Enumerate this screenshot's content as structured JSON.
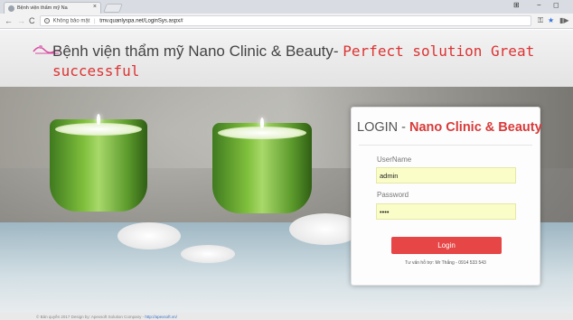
{
  "browser": {
    "tab_title": "Bệnh viện thẩm mỹ Na",
    "tab_close": "×",
    "window_controls": [
      "─",
      "−",
      "◻"
    ],
    "security_label": "Không bảo mật",
    "url": "tmv.quanlyspa.net/LoginSys.aspx#",
    "icons": [
      "key-icon",
      "star-icon",
      "extension-icon"
    ]
  },
  "header": {
    "title_main": "Bệnh viện thẩm mỹ Nano Clinic & Beauty-",
    "title_accent": "Perfect solution Great successful"
  },
  "login": {
    "title_prefix": "LOGIN - ",
    "title_brand": "Nano Clinic & Beauty",
    "username_label": "UserName",
    "username_value": "admin",
    "password_label": "Password",
    "password_value": "••••",
    "button_label": "Login",
    "support_text": "Tư vấn hỗ trợ: Mr Thắng - 0914 533 543"
  },
  "footer": {
    "left_text": "© Bản quyền 2017   Design by: Apexsoft Solution Company  -",
    "link_text": "http://apexsoft.vn/"
  }
}
